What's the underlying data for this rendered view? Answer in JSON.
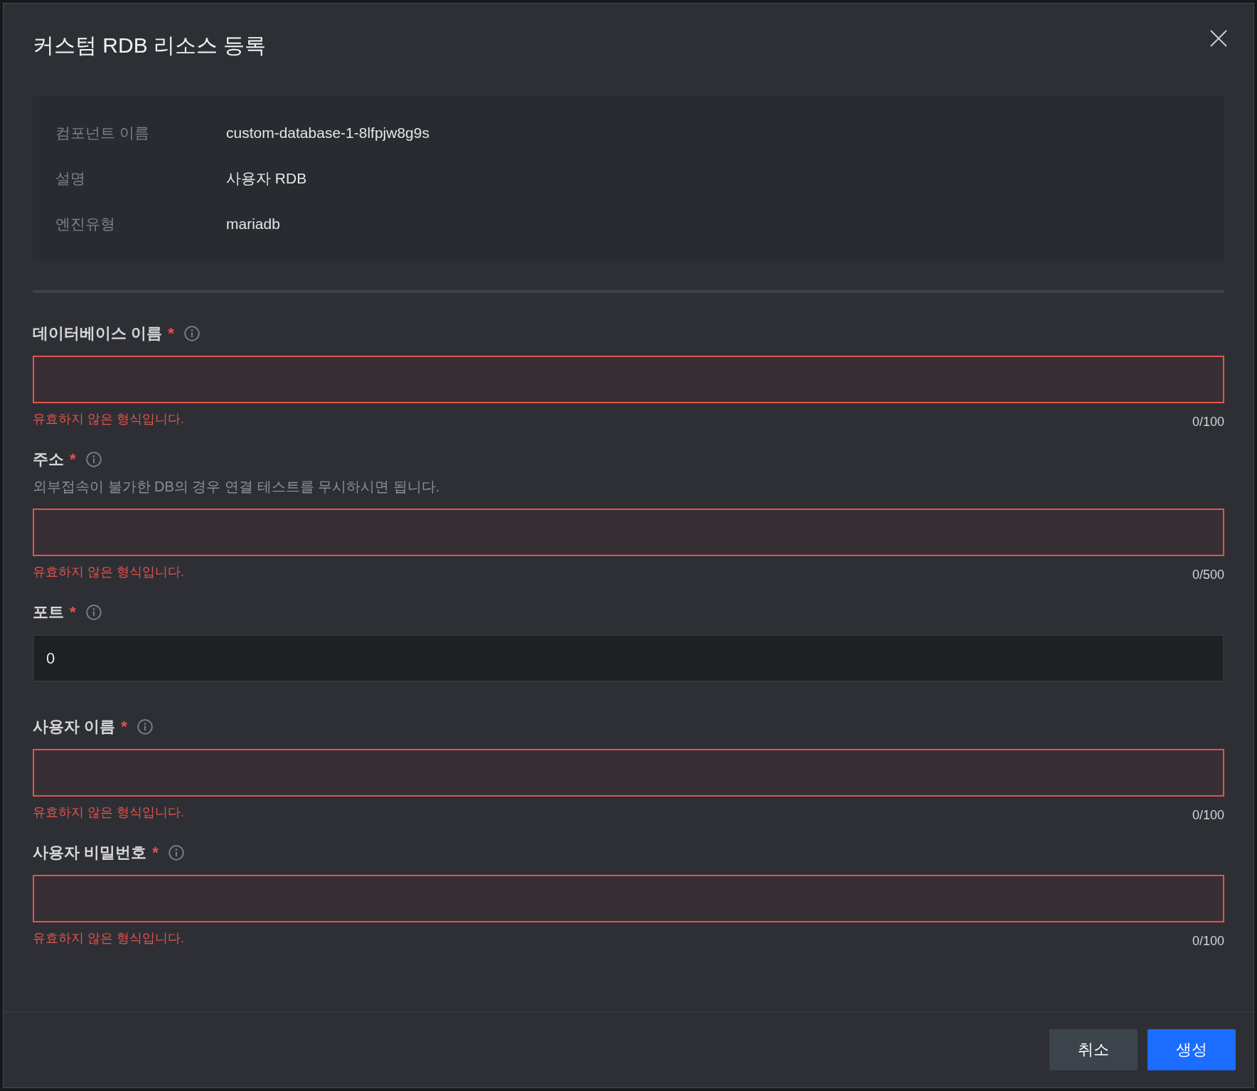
{
  "dialog": {
    "title": "커스텀 RDB 리소스 등록"
  },
  "summary": [
    {
      "label": "컴포넌트 이름",
      "value": "custom-database-1-8lfpjw8g9s"
    },
    {
      "label": "설명",
      "value": "사용자 RDB"
    },
    {
      "label": "엔진유형",
      "value": "mariadb"
    }
  ],
  "fields": [
    {
      "label": "데이터베이스 이름",
      "required_mark": "*",
      "invalid": true,
      "error": "유효하지 않은 형식입니다.",
      "counter": "0/100"
    },
    {
      "label": "주소",
      "required_mark": "*",
      "hint": "외부접속이 불가한 DB의 경우 연결 테스트를 무시하시면 됩니다.",
      "invalid": true,
      "error": "유효하지 않은 형식입니다.",
      "counter": "0/500"
    },
    {
      "label": "포트",
      "required_mark": "*",
      "value": "0",
      "invalid": false
    },
    {
      "label": "사용자 이름",
      "required_mark": "*",
      "invalid": true,
      "error": "유효하지 않은 형식입니다.",
      "counter": "0/100"
    },
    {
      "label": "사용자 비밀번호",
      "required_mark": "*",
      "invalid": true,
      "error": "유효하지 않은 형식입니다.",
      "counter": "0/100"
    }
  ],
  "buttons": [
    {
      "label": "취소",
      "kind": "secondary"
    },
    {
      "label": "생성",
      "kind": "primary"
    }
  ]
}
